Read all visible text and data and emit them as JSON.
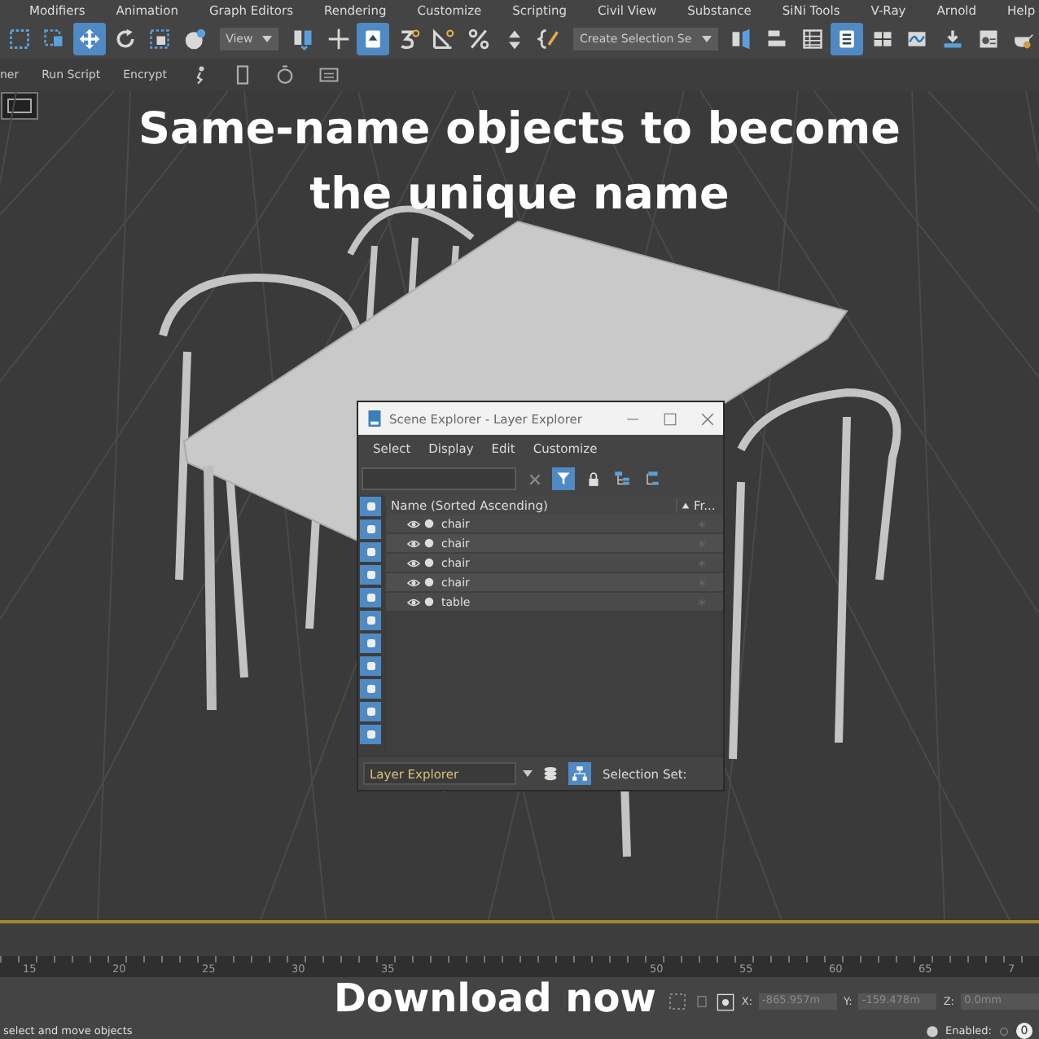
{
  "menu_bar": [
    "Modifiers",
    "Animation",
    "Graph Editors",
    "Rendering",
    "Customize",
    "Scripting",
    "Civil View",
    "Substance",
    "SiNi Tools",
    "V-Ray",
    "Arnold",
    "Help"
  ],
  "main_toolbar": {
    "tools_a": [
      {
        "selected": false
      },
      {
        "selected": false
      },
      {
        "selected": true
      },
      {
        "selected": false
      },
      {
        "selected": false
      },
      {
        "selected": false
      }
    ],
    "view_dropdown": "View",
    "tools_b": [
      {
        "selected": false
      },
      {
        "selected": false
      },
      {
        "selected": true
      },
      {
        "selected": false
      },
      {
        "selected": false
      },
      {
        "selected": false
      },
      {
        "selected": false
      },
      {
        "selected": false
      }
    ],
    "selection_set_dropdown": "Create Selection Se",
    "tools_c": [
      {
        "selected": false
      },
      {
        "selected": false
      },
      {
        "selected": false
      },
      {
        "selected": true
      },
      {
        "selected": false
      },
      {
        "selected": false
      },
      {
        "selected": false
      },
      {
        "selected": false
      },
      {
        "selected": false
      }
    ]
  },
  "script_toolbar": [
    "ner",
    "Run Script",
    "Encrypt"
  ],
  "caption": [
    "Same-name objects to become",
    "the unique name"
  ],
  "scene_explorer": {
    "title": "Scene Explorer - Layer Explorer",
    "menu": [
      "Select",
      "Display",
      "Edit",
      "Customize"
    ],
    "columns": [
      "Name (Sorted Ascending)",
      "Fr..."
    ],
    "rows": [
      {
        "name": "chair"
      },
      {
        "name": "chair"
      },
      {
        "name": "chair"
      },
      {
        "name": "chair"
      },
      {
        "name": "table"
      }
    ],
    "explorer_dropdown": "Layer Explorer",
    "selection_set_label": "Selection Set:"
  },
  "timeline": {
    "left_labels": [
      "15",
      "20",
      "25",
      "30",
      "35"
    ],
    "right_labels": [
      "50",
      "55",
      "60",
      "65",
      "7"
    ]
  },
  "download_caption": "Download now",
  "status_bar": {
    "prompt": "select and move objects",
    "coordinates": [
      {
        "label": "X:",
        "value": "-865.957m"
      },
      {
        "label": "Y:",
        "value": "-159.478m"
      },
      {
        "label": "Z:",
        "value": "0.0mm"
      }
    ],
    "enabled_label": "Enabled:",
    "counter": "0"
  }
}
